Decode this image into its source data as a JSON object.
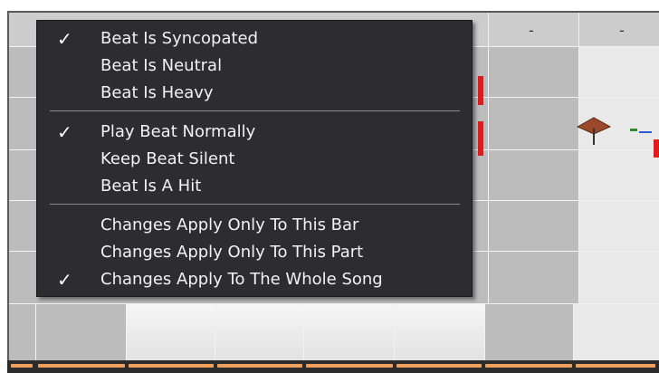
{
  "grid": {
    "header_dashes": [
      "-",
      "-"
    ]
  },
  "menu": {
    "groups": [
      [
        {
          "label": "Beat Is Syncopated",
          "checked": true
        },
        {
          "label": "Beat Is Neutral",
          "checked": false
        },
        {
          "label": "Beat Is Heavy",
          "checked": false
        }
      ],
      [
        {
          "label": "Play Beat Normally",
          "checked": true
        },
        {
          "label": "Keep Beat Silent",
          "checked": false
        },
        {
          "label": "Beat Is A Hit",
          "checked": false
        }
      ],
      [
        {
          "label": "Changes Apply Only To This Bar",
          "checked": false
        },
        {
          "label": "Changes Apply Only To This Part",
          "checked": false
        },
        {
          "label": "Changes Apply To The Whole Song",
          "checked": true
        }
      ]
    ],
    "check_glyph": "✓"
  },
  "colors": {
    "menu_bg": "#2d2d30",
    "accent_red": "#e11b1b",
    "bar_orange": "#f0a15e"
  },
  "icons": [
    "cymbal-icon",
    "checkmark-icon"
  ]
}
